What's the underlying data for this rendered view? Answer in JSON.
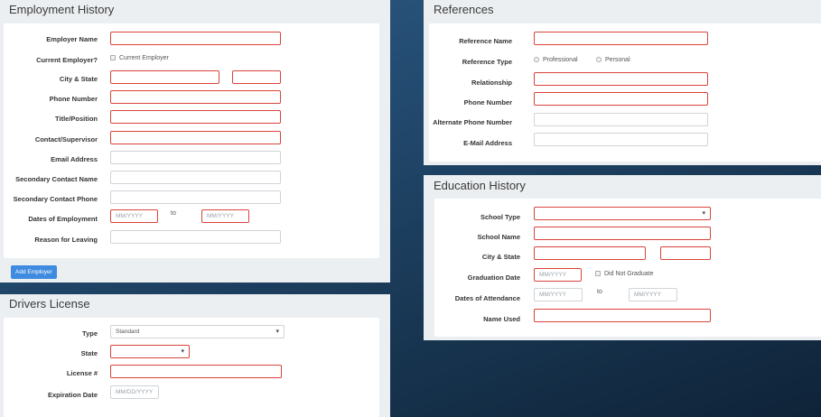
{
  "employment": {
    "title": "Employment History",
    "labels": {
      "employer_name": "Employer Name",
      "current_employer": "Current Employer?",
      "city_state": "City & State",
      "phone": "Phone Number",
      "title_position": "Title/Position",
      "contact": "Contact/Supervisor",
      "email": "Email Address",
      "sec_contact_name": "Secondary Contact Name",
      "sec_contact_phone": "Secondary Contact Phone",
      "dates": "Dates of Employment",
      "reason": "Reason for Leaving"
    },
    "current_employer_option": "Current Employer",
    "date_from_placeholder": "MM/YYYY",
    "date_to_placeholder": "MM/YYYY",
    "to_text": "to",
    "add_button": "Add Employer"
  },
  "license": {
    "title": "Drivers License",
    "labels": {
      "type": "Type",
      "state": "State",
      "license_no": "License #",
      "expiration": "Expiration Date"
    },
    "type_value": "Standard",
    "expiration_placeholder": "MM/DD/YYYY"
  },
  "references": {
    "title": "References",
    "labels": {
      "name": "Reference Name",
      "type": "Reference Type",
      "relationship": "Relationship",
      "phone": "Phone Number",
      "alt_phone": "Alternate Phone Number",
      "email": "E-Mail Address"
    },
    "type_options": [
      "Professional",
      "Personal"
    ]
  },
  "education": {
    "title": "Education History",
    "labels": {
      "school_type": "School Type",
      "school_name": "School Name",
      "city_state": "City & State",
      "graduation": "Graduation Date",
      "attendance": "Dates of Attendance",
      "name_used": "Name Used"
    },
    "graduation_placeholder": "MM/YYYY",
    "did_not_graduate": "Did Not Graduate",
    "attend_from_placeholder": "MM/YYYY",
    "attend_to_placeholder": "MM/YYYY",
    "to_text": "to"
  }
}
